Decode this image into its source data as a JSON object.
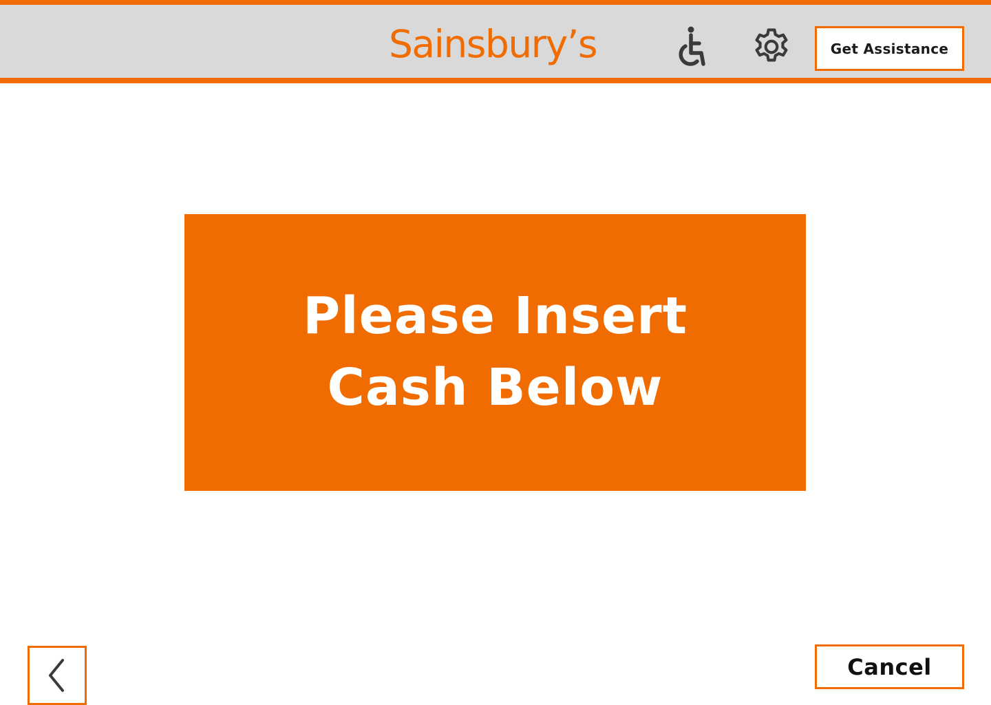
{
  "header": {
    "logo_text": "Sainsbury’s",
    "assist_label": "Get Assistance",
    "icons": {
      "accessibility": "wheelchair-icon",
      "settings": "gear-icon"
    }
  },
  "main": {
    "prompt_line1": "Please Insert",
    "prompt_line2": "Cash Below"
  },
  "footer": {
    "back_icon": "chevron-left-icon",
    "cancel_label": "Cancel"
  },
  "colors": {
    "brand_orange": "#f06c00",
    "header_gray": "#d9d9d9",
    "icon_dark": "#3a3a3a"
  }
}
